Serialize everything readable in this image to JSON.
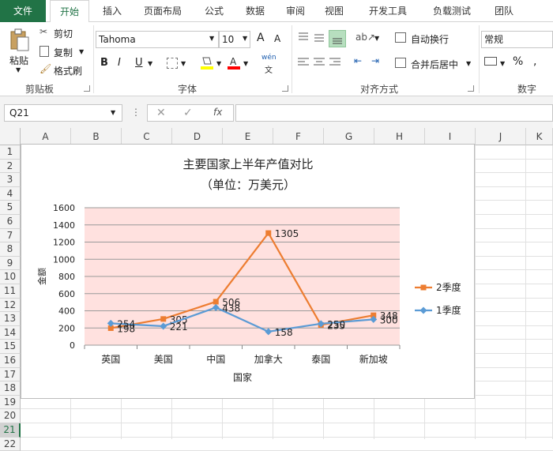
{
  "tabs": [
    "文件",
    "开始",
    "插入",
    "页面布局",
    "公式",
    "数据",
    "审阅",
    "视图",
    "开发工具",
    "负载测试",
    "团队"
  ],
  "clipboard": {
    "paste": "粘贴",
    "cut": "剪切",
    "copy": "复制",
    "painter": "格式刷",
    "label": "剪贴板"
  },
  "font": {
    "name": "Tahoma",
    "size": "10",
    "label": "字体",
    "bold": "B",
    "italic": "I",
    "underline": "U",
    "grow": "A",
    "shrink": "A",
    "phonetic": "wén"
  },
  "align": {
    "wrap": "自动换行",
    "merge": "合并后居中",
    "label": "对齐方式"
  },
  "number": {
    "format": "常规",
    "percent": "%",
    "label": "数字"
  },
  "formula_bar": {
    "name_box": "Q21",
    "cancel": "✕",
    "enter": "✓",
    "fx": "fx",
    "value": ""
  },
  "columns": [
    "A",
    "B",
    "C",
    "D",
    "E",
    "F",
    "G",
    "H",
    "I",
    "J",
    "K"
  ],
  "rows": [
    "1",
    "2",
    "3",
    "4",
    "5",
    "6",
    "7",
    "8",
    "9",
    "10",
    "11",
    "12",
    "13",
    "14",
    "15",
    "16",
    "17",
    "18",
    "19",
    "20",
    "21",
    "22"
  ],
  "selected_row": "21",
  "colors": {
    "excel_green": "#217346",
    "series_q2": "#ED7D31",
    "series_q1": "#5B9BD5",
    "plot_bg": "#FFE1DF"
  },
  "chart_data": {
    "type": "line",
    "title": "主要国家上半年产值对比",
    "subtitle": "（单位：万美元）",
    "xlabel": "国家",
    "ylabel": "金额",
    "categories": [
      "英国",
      "美国",
      "中国",
      "加拿大",
      "泰国",
      "新加坡"
    ],
    "ylim": [
      0,
      1600
    ],
    "yticks": [
      0,
      200,
      400,
      600,
      800,
      1000,
      1200,
      1400,
      1600
    ],
    "grid": true,
    "legend": "right",
    "series": [
      {
        "name": "2季度",
        "values": [
          198,
          305,
          506,
          1305,
          235,
          348
        ],
        "color": "#ED7D31",
        "marker": "square"
      },
      {
        "name": "1季度",
        "values": [
          254,
          221,
          438,
          158,
          250,
          300
        ],
        "color": "#5B9BD5",
        "marker": "diamond"
      }
    ]
  }
}
